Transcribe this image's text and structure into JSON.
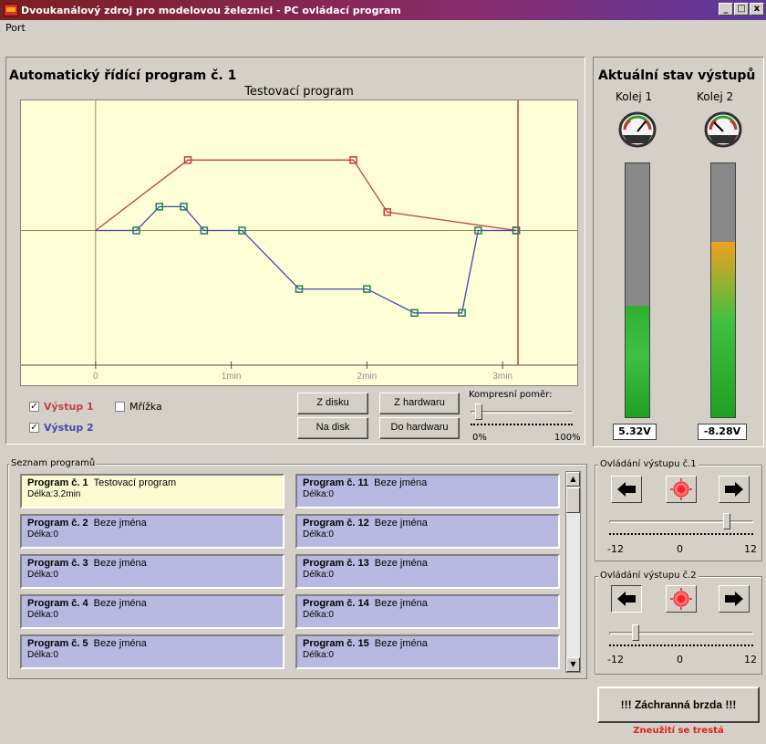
{
  "window": {
    "title": "Dvoukanálový zdroj pro modelovou železnici - PC ovládací program",
    "buttons": [
      "_",
      "□",
      "x"
    ]
  },
  "menu": {
    "items": [
      "Port"
    ]
  },
  "program_panel": {
    "heading": "Automatický řídící program č. 1",
    "chart_title": "Testovací program",
    "x_ticks": [
      "0",
      "1min",
      "2min",
      "3min"
    ],
    "colors": {
      "series1": "#c04040",
      "series2": "#4848b0",
      "marker": "#208060",
      "bg": "#fdfdd6"
    }
  },
  "chart_data": {
    "type": "line",
    "title": "Testovací program",
    "xlabel": "",
    "ylabel": "",
    "xlim": [
      -0.55,
      3.55
    ],
    "ylim": [
      -12,
      12
    ],
    "x_ticks": [
      0,
      1,
      2,
      3
    ],
    "x_tick_labels": [
      "0",
      "1min",
      "2min",
      "3min"
    ],
    "series": [
      {
        "name": "Výstup 1",
        "color": "#c04040",
        "points": [
          [
            0,
            0
          ],
          [
            0.68,
            6.5
          ],
          [
            1.9,
            6.5
          ],
          [
            2.15,
            1.7
          ],
          [
            3.1,
            0
          ]
        ]
      },
      {
        "name": "Výstup 2",
        "color": "#4848b0",
        "points": [
          [
            0,
            0
          ],
          [
            0.3,
            0
          ],
          [
            0.47,
            2.2
          ],
          [
            0.65,
            2.2
          ],
          [
            0.8,
            0
          ],
          [
            1.08,
            0
          ],
          [
            1.5,
            -5.4
          ],
          [
            2.0,
            -5.4
          ],
          [
            2.35,
            -7.6
          ],
          [
            2.7,
            -7.6
          ],
          [
            2.82,
            0
          ],
          [
            3.1,
            0
          ]
        ]
      }
    ],
    "marker_line_x": 3.1,
    "grid": false
  },
  "options": {
    "output1_label": "Výstup 1",
    "output2_label": "Výstup 2",
    "grid_label": "Mřížka",
    "output1_checked": true,
    "output2_checked": true,
    "grid_checked": false
  },
  "buttons": {
    "from_disk": "Z disku",
    "to_disk": "Na disk",
    "from_hw": "Z hardwaru",
    "to_hw": "Do hardwaru"
  },
  "compression": {
    "label": "Kompresní poměr:",
    "min": "0%",
    "max": "100%",
    "value_fraction": 0.05
  },
  "program_list": {
    "label": "Seznam programů",
    "items": [
      {
        "name": "Program č. 1",
        "desc": "Testovací program",
        "length": "Délka:3.2min",
        "selected": true
      },
      {
        "name": "Program č. 2",
        "desc": "Beze jména",
        "length": "Délka:0"
      },
      {
        "name": "Program č. 3",
        "desc": "Beze jména",
        "length": "Délka:0"
      },
      {
        "name": "Program č. 4",
        "desc": "Beze jména",
        "length": "Délka:0"
      },
      {
        "name": "Program č. 5",
        "desc": "Beze jména",
        "length": "Délka:0"
      },
      {
        "name": "Program č. 11",
        "desc": "Beze jména",
        "length": "Délka:0"
      },
      {
        "name": "Program č. 12",
        "desc": "Beze jména",
        "length": "Délka:0"
      },
      {
        "name": "Program č. 13",
        "desc": "Beze jména",
        "length": "Délka:0"
      },
      {
        "name": "Program č. 14",
        "desc": "Beze jména",
        "length": "Délka:0"
      },
      {
        "name": "Program č. 15",
        "desc": "Beze jména",
        "length": "Délka:0"
      }
    ]
  },
  "status_panel": {
    "heading": "Aktuální stav výstupů",
    "track1": {
      "label": "Kolej 1",
      "voltage": "5.32V",
      "level_fraction": 0.44,
      "fill_color": "#30b030"
    },
    "track2": {
      "label": "Kolej 2",
      "voltage": "-8.28V",
      "level_fraction": 0.69,
      "fill_color": "#f0a020"
    }
  },
  "control1": {
    "label": "Ovládání výstupu č.1",
    "min": "-12",
    "mid": "0",
    "max": "12",
    "value": 8
  },
  "control2": {
    "label": "Ovládání výstupu č.2",
    "min": "-12",
    "mid": "0",
    "max": "12",
    "value": -8
  },
  "emergency": {
    "label": "!!! Záchranná brzda !!!",
    "note": "Zneužití se trestá"
  }
}
